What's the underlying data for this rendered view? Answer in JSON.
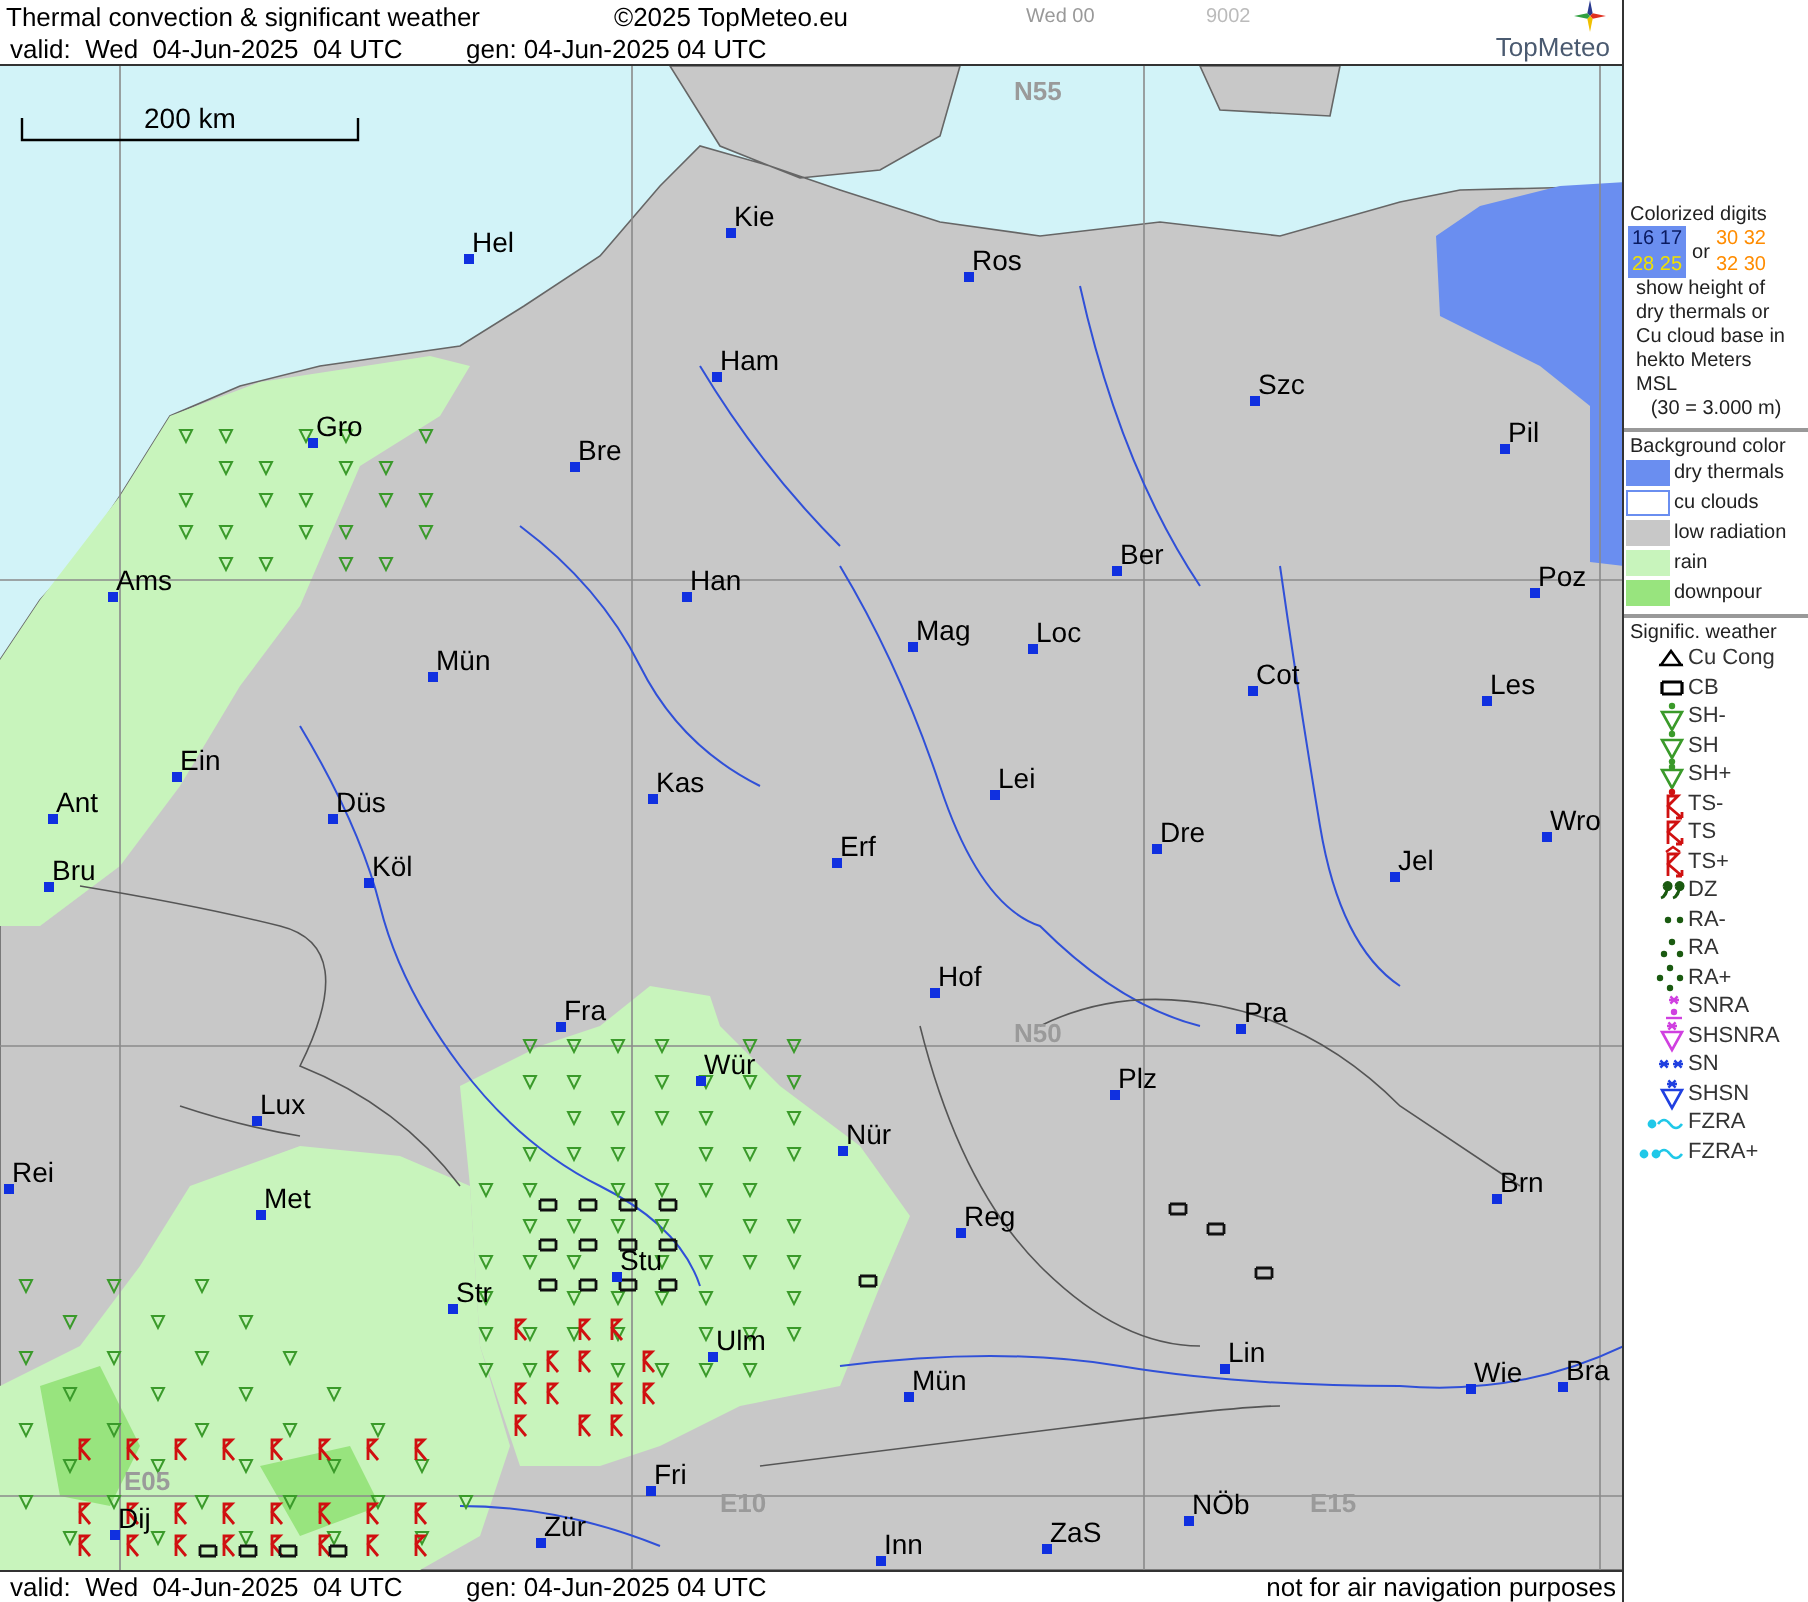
{
  "header": {
    "title": "Thermal convection & significant weather",
    "copyright": "©2025 TopMeteo.eu",
    "run_label": "Wed 00",
    "code": "9002",
    "valid": "valid:  Wed  04-Jun-2025  04 UTC",
    "generated": "gen: 04-Jun-2025 04 UTC",
    "logo": "TopMeteo"
  },
  "map": {
    "scale_label": "200 km",
    "grid_labels": [
      "N55",
      "N50",
      "E05",
      "E10",
      "E15"
    ],
    "cities": [
      {
        "name": "Hel"
      },
      {
        "name": "Kie"
      },
      {
        "name": "Ros"
      },
      {
        "name": "Ham"
      },
      {
        "name": "Szc"
      },
      {
        "name": "Gro"
      },
      {
        "name": "Bre"
      },
      {
        "name": "Pil"
      },
      {
        "name": "Ams"
      },
      {
        "name": "Han"
      },
      {
        "name": "Ber"
      },
      {
        "name": "Poz"
      },
      {
        "name": "Mün"
      },
      {
        "name": "Mag"
      },
      {
        "name": "Loc"
      },
      {
        "name": "Cot"
      },
      {
        "name": "Les"
      },
      {
        "name": "Ein"
      },
      {
        "name": "Kas"
      },
      {
        "name": "Lei"
      },
      {
        "name": "Ant"
      },
      {
        "name": "Düs"
      },
      {
        "name": "Bru"
      },
      {
        "name": "Köl"
      },
      {
        "name": "Erf"
      },
      {
        "name": "Dre"
      },
      {
        "name": "Wro"
      },
      {
        "name": "Jel"
      },
      {
        "name": "Hof"
      },
      {
        "name": "Fra"
      },
      {
        "name": "Pra"
      },
      {
        "name": "Wür"
      },
      {
        "name": "Plz"
      },
      {
        "name": "Lux"
      },
      {
        "name": "Nür"
      },
      {
        "name": "Rei"
      },
      {
        "name": "Met"
      },
      {
        "name": "Reg"
      },
      {
        "name": "Brn"
      },
      {
        "name": "Str"
      },
      {
        "name": "Stu"
      },
      {
        "name": "Ulm"
      },
      {
        "name": "Mün"
      },
      {
        "name": "Lin"
      },
      {
        "name": "Wie"
      },
      {
        "name": "Bra"
      },
      {
        "name": "Fri"
      },
      {
        "name": "Dij"
      },
      {
        "name": "Zür"
      },
      {
        "name": "Inn"
      },
      {
        "name": "ZaS"
      },
      {
        "name": "NÖb"
      }
    ]
  },
  "legend": {
    "digits_title": "Colorized digits",
    "thermal_digits": [
      {
        "text": "16 17",
        "color": "#0a1a60"
      },
      {
        "text": "28 25",
        "color": "#f0e000"
      }
    ],
    "or_label": "or",
    "cloud_digits": [
      {
        "text": "30 32",
        "color": "#ff8c00"
      },
      {
        "text": "32 30",
        "color": "#ff8c00"
      }
    ],
    "digits_note": "show height of dry thermals or Cu cloud base in hekto Meters MSL",
    "digits_example": "(30 = 3.000 m)",
    "background_title": "Background color",
    "backgrounds": [
      {
        "label": "dry thermals",
        "color": "#6a8ef0"
      },
      {
        "label": "cu clouds",
        "color": "#ffffff"
      },
      {
        "label": "low radiation",
        "color": "#c8c8c8"
      },
      {
        "label": "rain",
        "color": "#c8f4bc"
      },
      {
        "label": "downpour",
        "color": "#98e47e"
      }
    ],
    "weather_title": "Signific. weather",
    "weather": [
      {
        "label": "Cu Cong",
        "kind": "cu_cong"
      },
      {
        "label": "CB",
        "kind": "cb"
      },
      {
        "label": "SH-",
        "kind": "sh_light"
      },
      {
        "label": "SH",
        "kind": "sh"
      },
      {
        "label": "SH+",
        "kind": "sh_heavy"
      },
      {
        "label": "TS-",
        "kind": "ts_light"
      },
      {
        "label": "TS",
        "kind": "ts"
      },
      {
        "label": "TS+",
        "kind": "ts_heavy"
      },
      {
        "label": "DZ",
        "kind": "dz"
      },
      {
        "label": "RA-",
        "kind": "ra_light"
      },
      {
        "label": "RA",
        "kind": "ra"
      },
      {
        "label": "RA+",
        "kind": "ra_heavy"
      },
      {
        "label": "SNRA",
        "kind": "snra"
      },
      {
        "label": "SHSNRA",
        "kind": "shsnra"
      },
      {
        "label": "SN",
        "kind": "sn"
      },
      {
        "label": "SHSN",
        "kind": "shsn"
      },
      {
        "label": "FZRA",
        "kind": "fzra"
      },
      {
        "label": "FZRA+",
        "kind": "fzra_heavy"
      }
    ]
  },
  "footer": {
    "valid": "valid:  Wed  04-Jun-2025  04 UTC",
    "generated": "gen: 04-Jun-2025 04 UTC",
    "note": "not for air navigation purposes"
  }
}
